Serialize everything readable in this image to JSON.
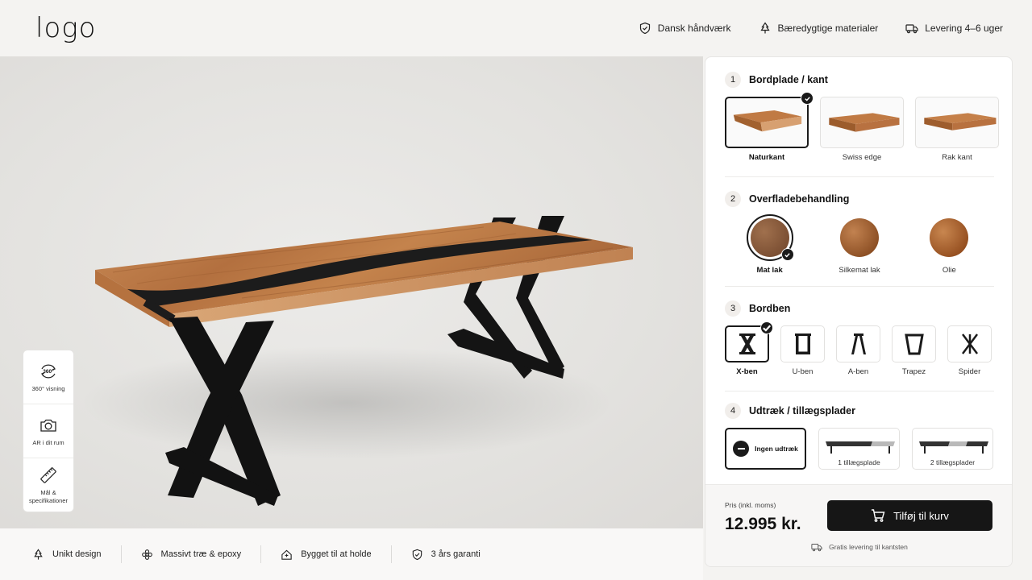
{
  "brand": {
    "logo_text": "logo"
  },
  "header": {
    "usps": [
      {
        "label": "Dansk håndværk",
        "icon": "shield-check-icon"
      },
      {
        "label": "Bæredygtige materialer",
        "icon": "tree-icon"
      },
      {
        "label": "Levering 4–6 uger",
        "icon": "truck-icon"
      }
    ]
  },
  "tools": [
    {
      "label": "360° visning",
      "icon": "rotate-360-icon",
      "badge": "360°"
    },
    {
      "label": "AR i dit rum",
      "icon": "camera-icon"
    },
    {
      "label": "Mål & specifikationer",
      "icon": "ruler-icon"
    }
  ],
  "features": [
    {
      "label": "Unikt design",
      "icon": "tree-icon"
    },
    {
      "label": "Massivt træ & epoxy",
      "icon": "flower-icon"
    },
    {
      "label": "Bygget til at holde",
      "icon": "house-icon"
    },
    {
      "label": "3 års garanti",
      "icon": "shield-check-icon"
    }
  ],
  "config": {
    "sections": [
      {
        "number": "1",
        "title": "Bordplade / kant",
        "options": [
          {
            "label": "Naturkant",
            "selected": true
          },
          {
            "label": "Swiss edge",
            "selected": false
          },
          {
            "label": "Rak kant",
            "selected": false
          }
        ]
      },
      {
        "number": "2",
        "title": "Overfladebehandling",
        "options": [
          {
            "label": "Mat lak",
            "selected": true,
            "color": "#8a5a3a"
          },
          {
            "label": "Silkemat lak",
            "selected": false,
            "color": "#a0612f"
          },
          {
            "label": "Olie",
            "selected": false,
            "color": "#a8622c"
          }
        ]
      },
      {
        "number": "3",
        "title": "Bordben",
        "options": [
          {
            "label": "X-ben",
            "selected": true
          },
          {
            "label": "U-ben",
            "selected": false
          },
          {
            "label": "A-ben",
            "selected": false
          },
          {
            "label": "Trapez",
            "selected": false
          },
          {
            "label": "Spider",
            "selected": false
          }
        ]
      },
      {
        "number": "4",
        "title": "Udtræk / tillægsplader",
        "options": [
          {
            "label": "Ingen udtræk",
            "selected": true
          },
          {
            "label": "1 tillægsplade",
            "selected": false
          },
          {
            "label": "2 tillægsplader",
            "selected": false
          }
        ]
      }
    ]
  },
  "checkout": {
    "price_label": "Pris (inkl. moms)",
    "price": "12.995 kr.",
    "cta_label": "Tilføj til kurv",
    "shipping_note": "Gratis levering til kantsten"
  },
  "colors": {
    "accent": "#161616",
    "background": "#f4f3f1",
    "wood": "#b06c3a",
    "epoxy": "#1c1c1c"
  }
}
